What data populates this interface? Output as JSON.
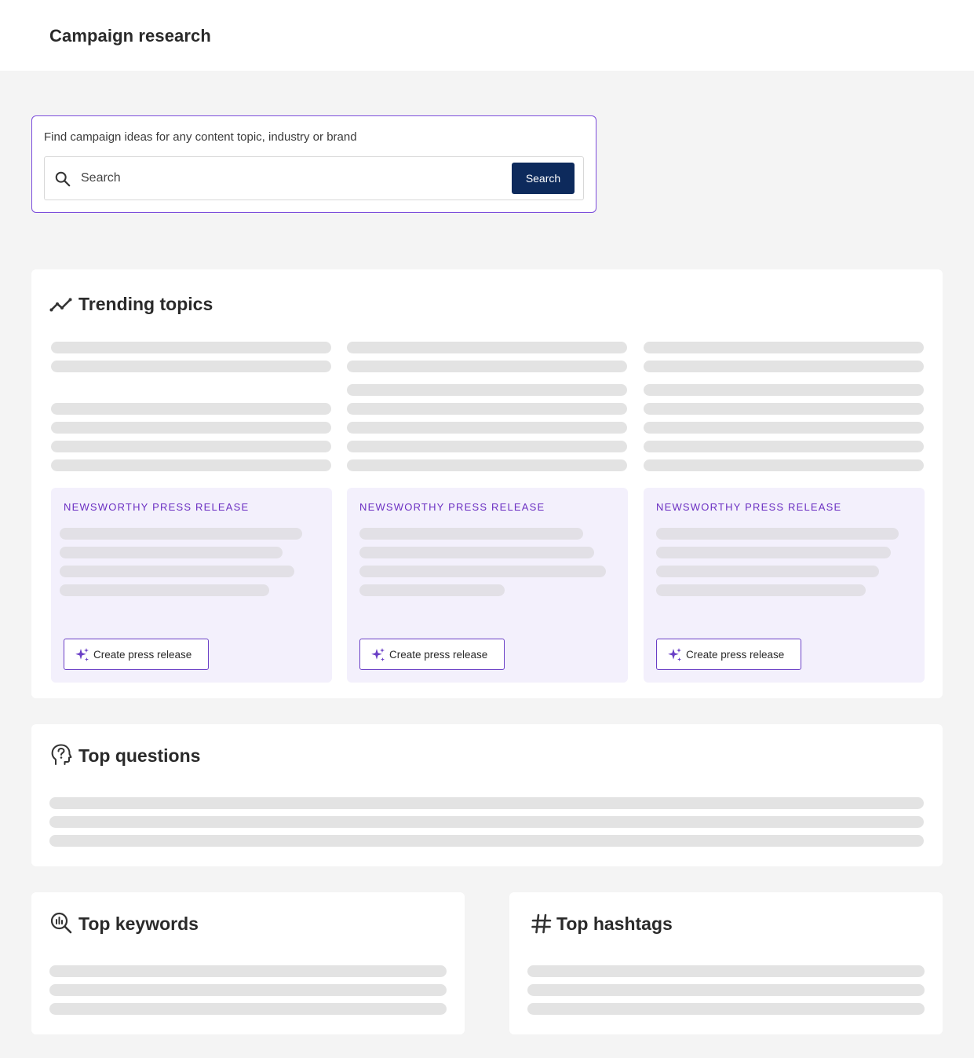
{
  "header": {
    "title": "Campaign research"
  },
  "search": {
    "prompt": "Find campaign ideas for any content topic, industry or brand",
    "placeholder": "Search",
    "button_label": "Search"
  },
  "trending": {
    "title": "Trending topics",
    "icon": "trend-line-icon",
    "columns": [
      {
        "label": "NEWSWORTHY PRESS RELEASE",
        "button_label": "Create press release"
      },
      {
        "label": "NEWSWORTHY PRESS RELEASE",
        "button_label": "Create press release"
      },
      {
        "label": "NEWSWORTHY PRESS RELEASE",
        "button_label": "Create press release"
      }
    ]
  },
  "questions": {
    "title": "Top questions",
    "icon": "question-head-icon"
  },
  "keywords": {
    "title": "Top keywords",
    "icon": "search-chart-icon"
  },
  "hashtags": {
    "title": "Top hashtags",
    "icon": "hashtag-icon"
  },
  "colors": {
    "accent": "#7c4ddb",
    "label_purple": "#6b2fc2",
    "search_button": "#0d2a5c",
    "panel_background": "#f3f0fc",
    "skeleton": "#e3e3e3",
    "page_background": "#f4f4f4"
  }
}
